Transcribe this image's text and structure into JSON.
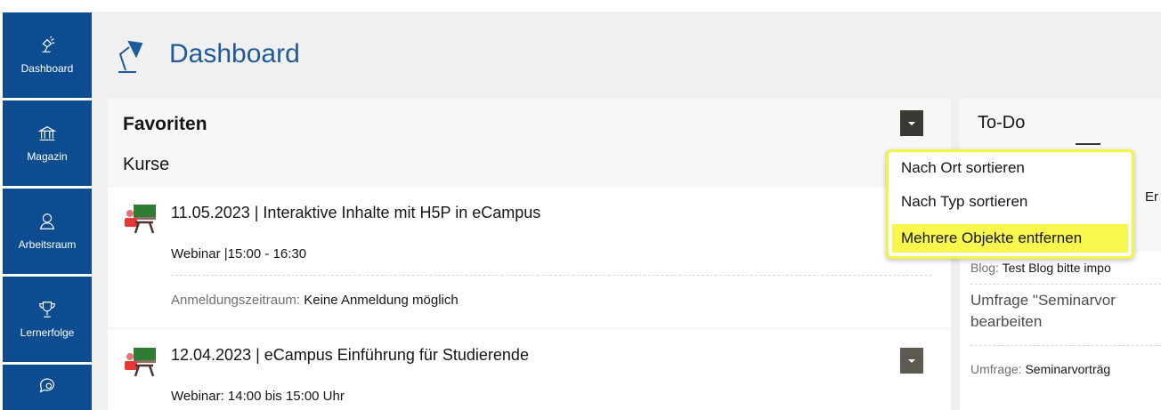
{
  "mainbar": {
    "items": [
      {
        "label": "Dashboard",
        "icon": "dashboard-icon"
      },
      {
        "label": "Magazin",
        "icon": "bank-icon"
      },
      {
        "label": "Arbeitsraum",
        "icon": "user-icon"
      },
      {
        "label": "Lernerfolge",
        "icon": "trophy-icon"
      },
      {
        "label": "",
        "icon": "chat-icon"
      }
    ]
  },
  "header": {
    "title": "Dashboard"
  },
  "favorites": {
    "title": "Favoriten",
    "section": "Kurse",
    "items": [
      {
        "title": "11.05.2023 | Interaktive Inhalte mit H5P in eCampus",
        "meta": "Webinar |15:00 - 16:30",
        "prop_key": "Anmeldungszeitraum:",
        "prop_value": "Keine Anmeldung möglich"
      },
      {
        "title": "12.04.2023 | eCampus Einführung für Studierende",
        "meta": "Webinar: 14:00 bis 15:00 Uhr"
      }
    ]
  },
  "todo": {
    "title": "To-Do",
    "fragment": "Er",
    "rows": {
      "blog_key": "Blog:",
      "blog_value": "Test Blog bitte impo",
      "survey_title": "Umfrage \"Seminarvor bearbeiten",
      "survey_key": "Umfrage:",
      "survey_value": "Seminarvorträg"
    }
  },
  "dropdown": {
    "items": [
      "Nach Ort sortieren",
      "Nach Typ sortieren",
      "Mehrere Objekte entfernen"
    ]
  },
  "colors": {
    "mainbar": "#0e4c92",
    "title": "#1f5a99",
    "highlight": "#f7f74e"
  }
}
